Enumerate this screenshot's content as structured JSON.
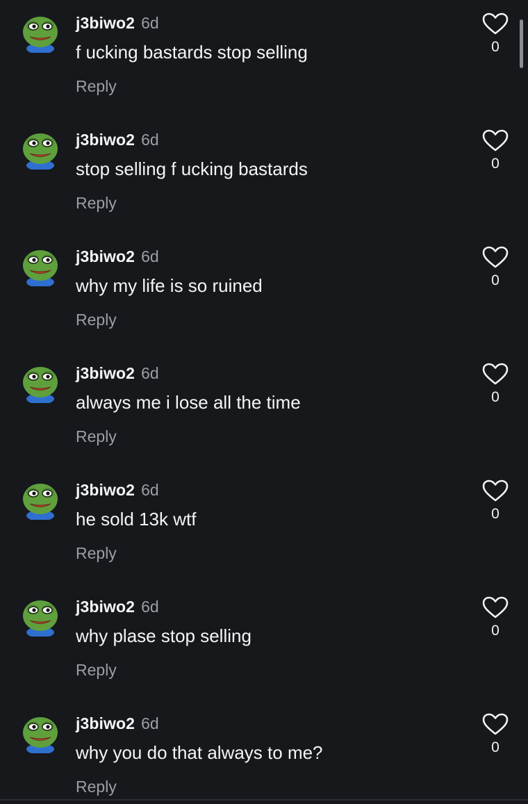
{
  "colors": {
    "background": "#16181c",
    "primary_text": "#f4f5f7",
    "secondary_text": "#9a9ea6",
    "avatar_green": "#5fa03d",
    "avatar_mouth": "#b24a2f",
    "avatar_shirt": "#2f6fd0"
  },
  "icons": {
    "avatar": "pepe-frog-icon",
    "like": "heart-outline-icon"
  },
  "comments": [
    {
      "username": "j3biwo2",
      "time": "6d",
      "text": "f ucking bastards stop selling",
      "reply_label": "Reply",
      "likes": "0"
    },
    {
      "username": "j3biwo2",
      "time": "6d",
      "text": "stop selling f ucking bastards",
      "reply_label": "Reply",
      "likes": "0"
    },
    {
      "username": "j3biwo2",
      "time": "6d",
      "text": "why my life is so ruined",
      "reply_label": "Reply",
      "likes": "0"
    },
    {
      "username": "j3biwo2",
      "time": "6d",
      "text": "always me i lose all the time",
      "reply_label": "Reply",
      "likes": "0"
    },
    {
      "username": "j3biwo2",
      "time": "6d",
      "text": "he sold 13k wtf",
      "reply_label": "Reply",
      "likes": "0"
    },
    {
      "username": "j3biwo2",
      "time": "6d",
      "text": "why plase stop selling",
      "reply_label": "Reply",
      "likes": "0"
    },
    {
      "username": "j3biwo2",
      "time": "6d",
      "text": "why you do that always to me?",
      "reply_label": "Reply",
      "likes": "0"
    }
  ]
}
